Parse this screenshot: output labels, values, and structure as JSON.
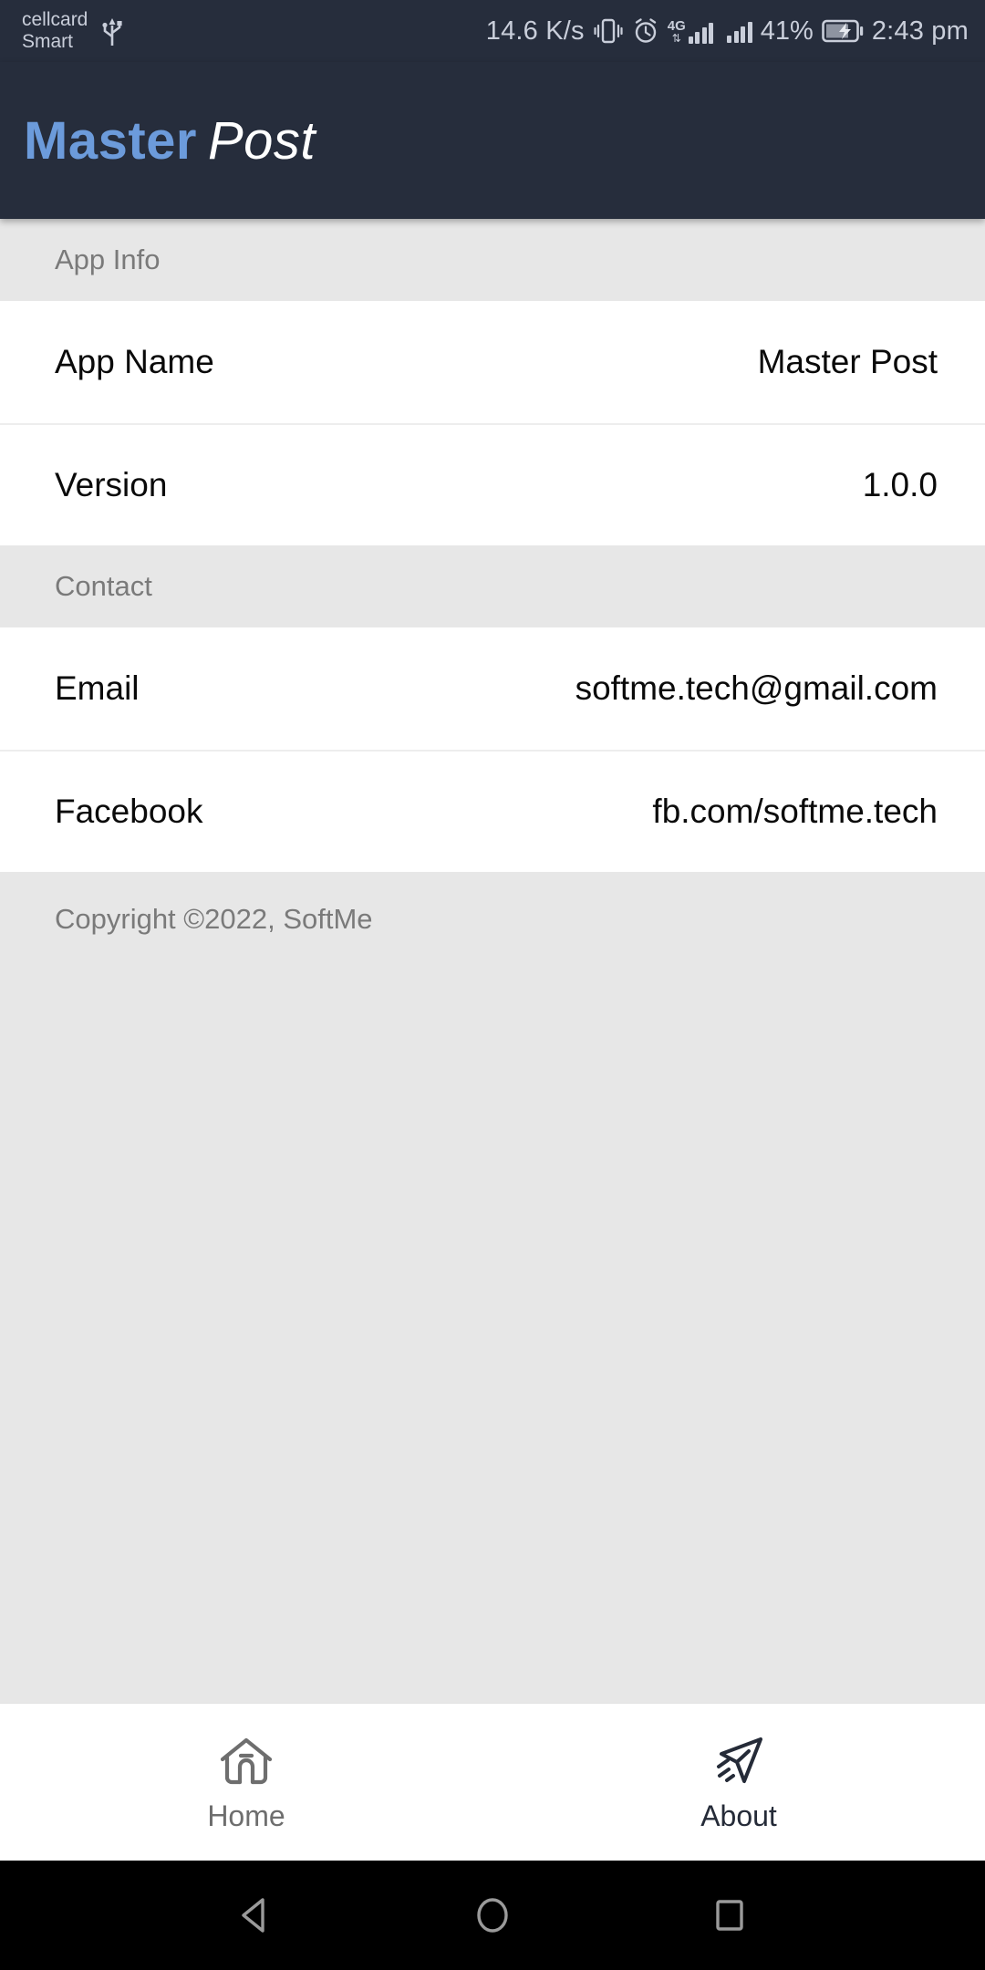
{
  "statusbar": {
    "carrier_line1": "cellcard",
    "carrier_line2": "Smart",
    "usb_icon": "usb-icon",
    "network_speed": "14.6 K/s",
    "vibrate_icon": "vibrate-icon",
    "alarm_icon": "alarm-clock-icon",
    "network_type": "4G",
    "network_arrows": "⇅",
    "signal_icon_1": "signal-bars-icon",
    "signal_icon_2": "signal-bars-icon",
    "battery_percent": "41%",
    "battery_icon": "battery-charging-icon",
    "clock": "2:43 pm",
    "text_color": "#C9CEDA",
    "background": "#262D3C"
  },
  "appbar": {
    "brand_bold": "Master",
    "brand_italic": "Post",
    "brand_color": "#6C9BDB",
    "background": "#262D3C"
  },
  "sections": [
    {
      "header": "App Info",
      "rows": [
        {
          "label": "App Name",
          "value": "Master Post"
        },
        {
          "label": "Version",
          "value": "1.0.0"
        }
      ]
    },
    {
      "header": "Contact",
      "rows": [
        {
          "label": "Email",
          "value": "softme.tech@gmail.com"
        },
        {
          "label": "Facebook",
          "value": "fb.com/softme.tech"
        }
      ]
    }
  ],
  "copyright": "Copyright ©2022, SoftMe",
  "tabbar": {
    "tabs": [
      {
        "label": "Home",
        "icon": "home-icon",
        "active": false
      },
      {
        "label": "About",
        "icon": "send-plane-icon",
        "active": true
      }
    ],
    "active_color": "#252B38",
    "inactive_color": "#6E6E6E"
  },
  "sysnav": {
    "back": "back-triangle-icon",
    "home": "home-circle-icon",
    "recents": "recents-square-icon",
    "background": "#000000",
    "icon_color": "#9A9A9A"
  }
}
